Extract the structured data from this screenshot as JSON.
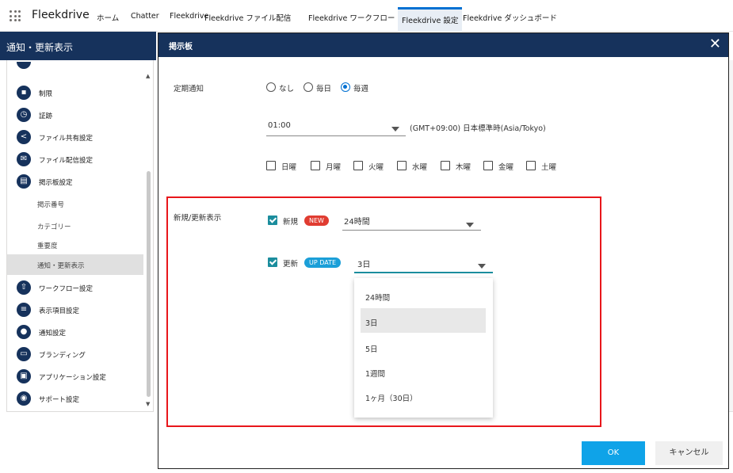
{
  "nav": {
    "app_name": "Fleekdrive",
    "tabs": [
      "ホーム",
      "Chatter",
      "Fleekdrive",
      "Fleekdrive ファイル配信",
      "Fleekdrive ワークフロー",
      "Fleekdrive 設定",
      "Fleekdrive ダッシュボード"
    ],
    "active_tab": "Fleekdrive 設定"
  },
  "left": {
    "header": "通知・更新表示",
    "items": [
      {
        "label": "制限",
        "icon": "info-icon"
      },
      {
        "label": "証跡",
        "icon": "clock-icon"
      },
      {
        "label": "ファイル共有設定",
        "icon": "share-icon"
      },
      {
        "label": "ファイル配信設定",
        "icon": "mail-icon"
      },
      {
        "label": "掲示板設定",
        "icon": "board-icon"
      }
    ],
    "subitems": [
      "掲示番号",
      "カテゴリー",
      "重要度",
      "通知・更新表示"
    ],
    "active_subitem": "通知・更新表示",
    "items_after": [
      {
        "label": "ワークフロー設定",
        "icon": "upload-icon"
      },
      {
        "label": "表示項目設定",
        "icon": "list-icon"
      },
      {
        "label": "通知設定",
        "icon": "bell-icon"
      },
      {
        "label": "ブランディング",
        "icon": "brand-icon"
      },
      {
        "label": "アプリケーション設定",
        "icon": "app-icon"
      },
      {
        "label": "サポート設定",
        "icon": "support-icon"
      }
    ]
  },
  "modal": {
    "title": "掲示板",
    "close": "✕",
    "periodic": {
      "label": "定期通知",
      "options": [
        "なし",
        "毎日",
        "毎週"
      ],
      "selected": "毎週",
      "time": "01:00",
      "timezone": "(GMT+09:00) 日本標準時(Asia/Tokyo)",
      "days": [
        "日曜",
        "月曜",
        "火曜",
        "水曜",
        "木曜",
        "金曜",
        "土曜"
      ]
    },
    "update": {
      "label": "新規/更新表示",
      "new_label": "新規",
      "new_badge": "NEW",
      "new_value": "24時間",
      "update_label": "更新",
      "update_badge": "UP DATE",
      "update_value": "3日",
      "options": [
        "24時間",
        "3日",
        "5日",
        "1週間",
        "1ヶ月（30日）"
      ],
      "selected": "3日"
    },
    "ok": "OK",
    "cancel": "キャンセル"
  },
  "colors": {
    "header_navy": "#16325c",
    "accent_blue": "#0070d2",
    "checkbox_teal": "#1b8d9d",
    "new_badge": "#e03c31",
    "update_badge": "#1b9fd8",
    "highlight_red": "#e8161b",
    "ok_button": "#0fa3e8"
  }
}
